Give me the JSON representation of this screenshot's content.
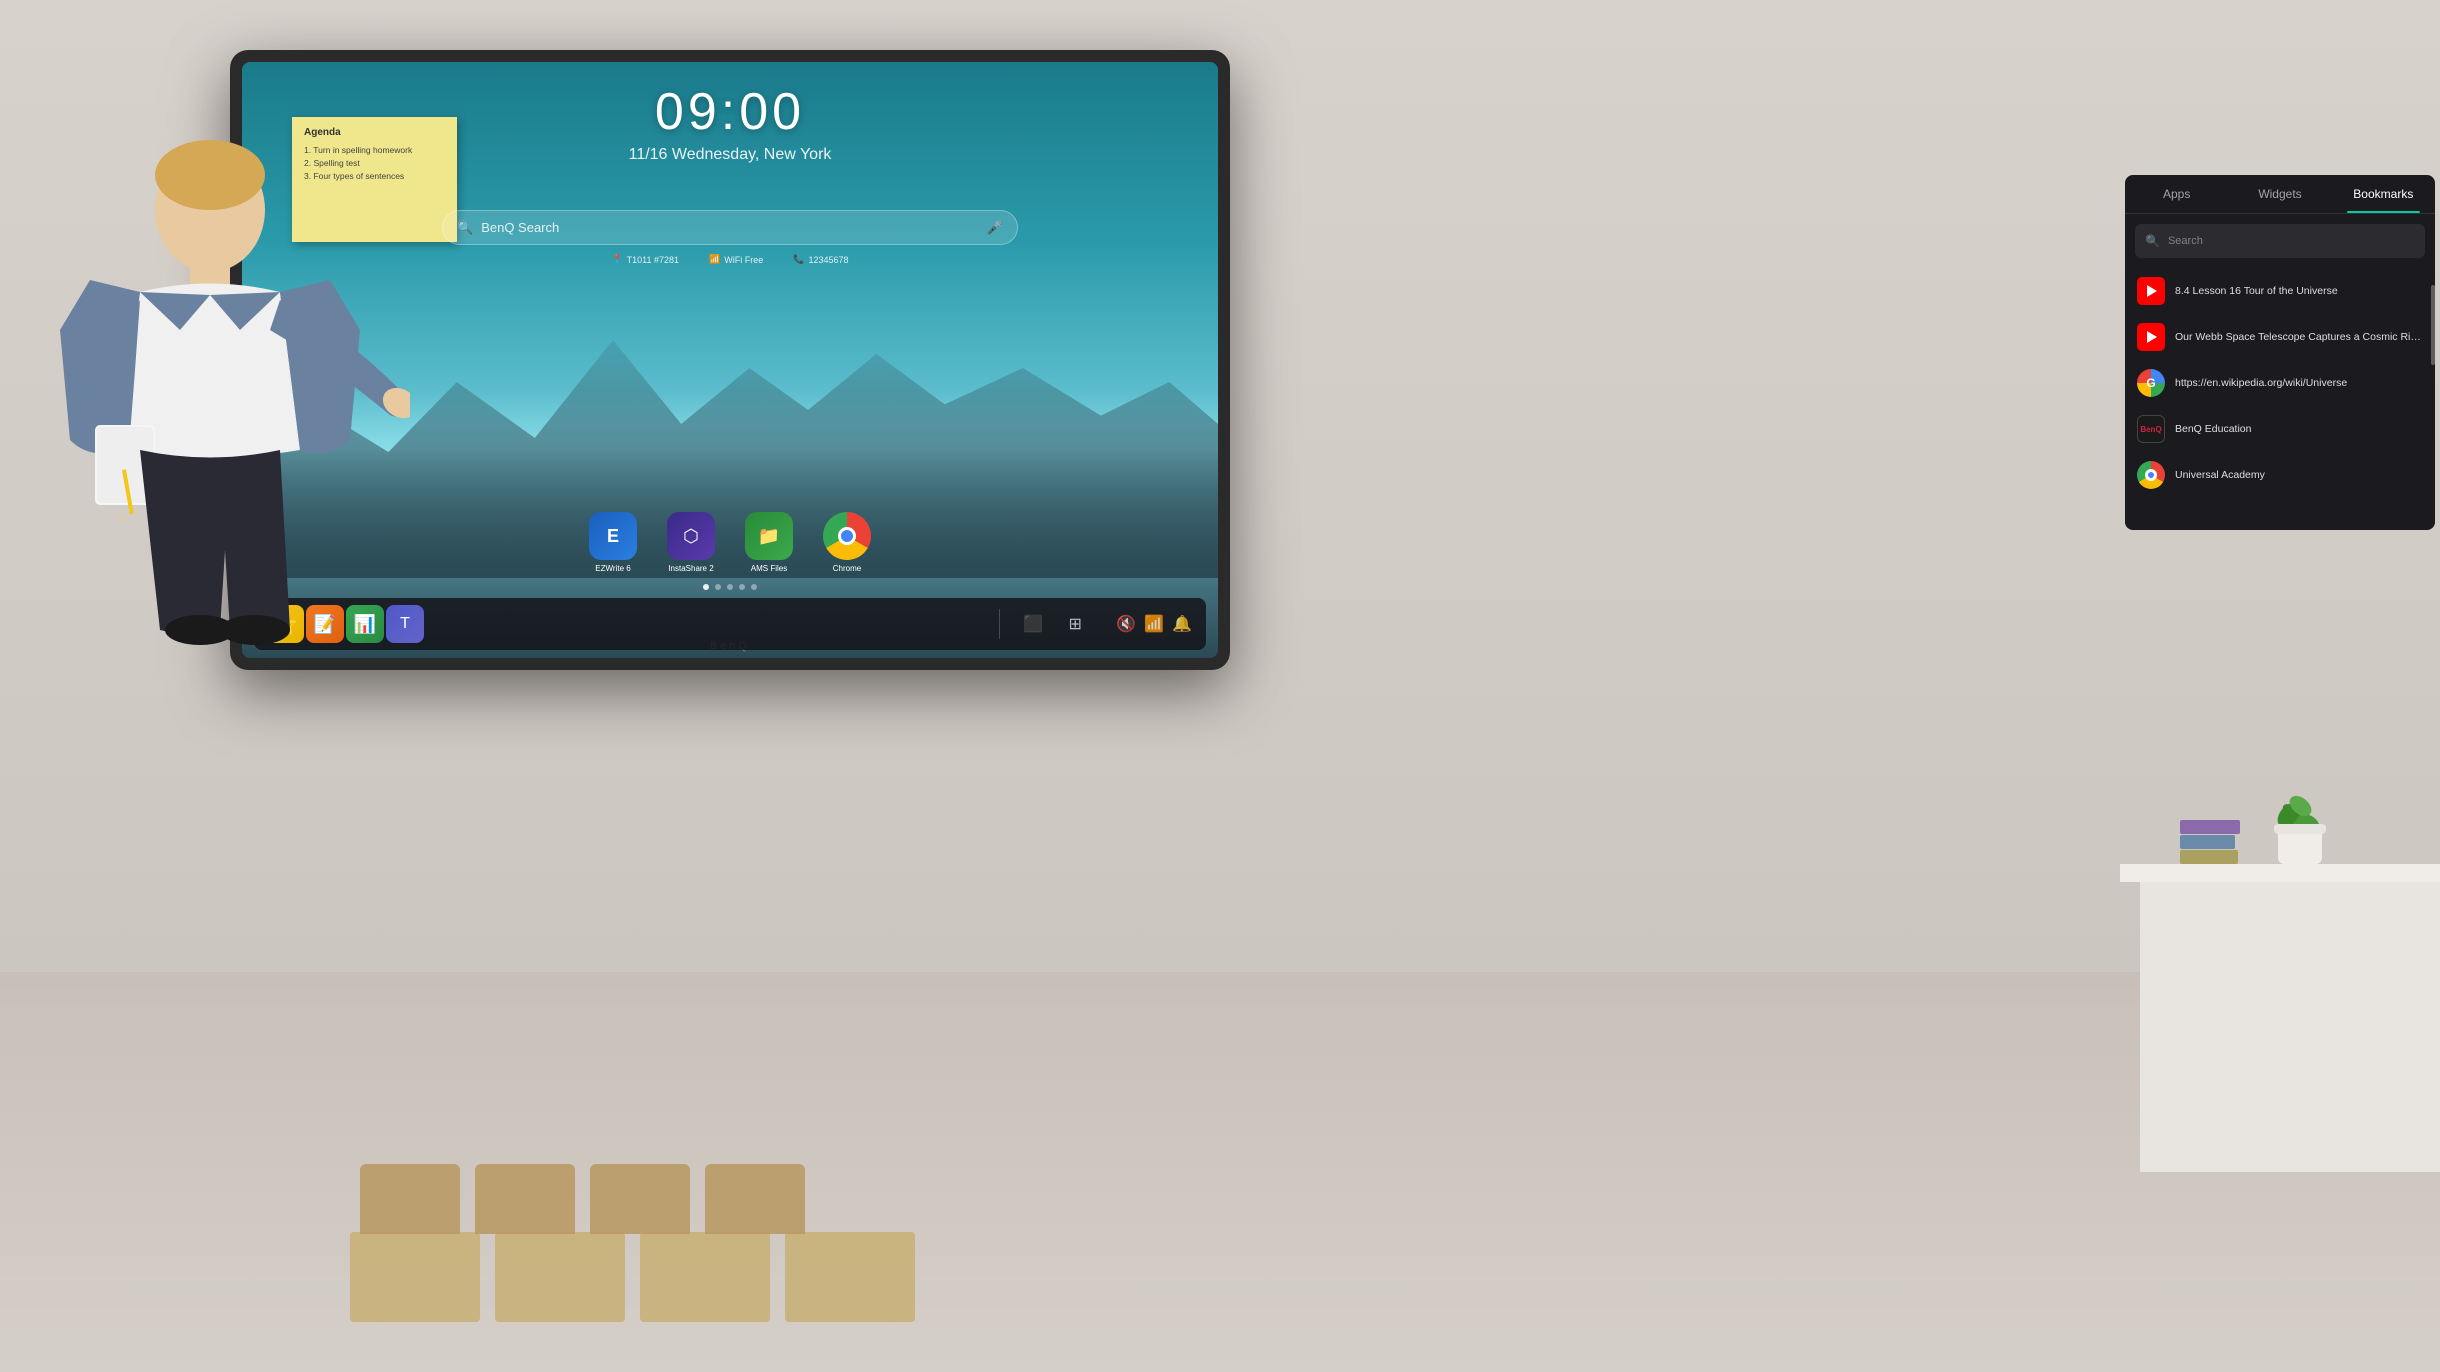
{
  "room": {
    "background": "#c8c0b8"
  },
  "tv": {
    "brand": "BenQ",
    "time": "09:00",
    "date": "11/16 Wednesday, New York",
    "search_placeholder": "BenQ Search",
    "info": {
      "device_id": "T1011 #7281",
      "wifi": "WiFi Free",
      "phone": "12345678"
    },
    "dots": [
      true,
      false,
      false,
      false,
      false
    ]
  },
  "sticky_note": {
    "title": "Agenda",
    "items": [
      "1.  Turn in spelling homework",
      "2.  Spelling test",
      "3.  Four types of sentences"
    ]
  },
  "apps": [
    {
      "label": "EZWrite 6",
      "icon_type": "ezwrite"
    },
    {
      "label": "InstaShare 2",
      "icon_type": "instashare"
    },
    {
      "label": "AMS Files",
      "icon_type": "ams"
    },
    {
      "label": "Chrome",
      "icon_type": "chrome"
    }
  ],
  "taskbar": {
    "left_icons": [
      {
        "name": "star-widget-icon",
        "type": "yellow"
      },
      {
        "name": "sticky-notes-icon",
        "type": "orange"
      },
      {
        "name": "sheets-icon",
        "type": "green"
      },
      {
        "name": "teams-icon",
        "type": "blue"
      }
    ],
    "right_icons": [
      {
        "name": "mute-icon",
        "symbol": "🔇"
      },
      {
        "name": "wifi-icon",
        "symbol": "📶"
      },
      {
        "name": "bell-icon",
        "symbol": "🔔"
      }
    ],
    "center_icons": [
      {
        "name": "input-source-icon",
        "symbol": "⬛"
      },
      {
        "name": "grid-icon",
        "symbol": "⊞"
      }
    ]
  },
  "bookmarks_panel": {
    "tabs": [
      {
        "label": "Apps",
        "active": false
      },
      {
        "label": "Widgets",
        "active": false
      },
      {
        "label": "Bookmarks",
        "active": true
      }
    ],
    "search_placeholder": "Search",
    "items": [
      {
        "title": "8.4 Lesson 16 Tour of the Universe",
        "icon_type": "youtube",
        "url": ""
      },
      {
        "title": "Our Webb Space Telescope Captures a Cosmic Ring on...",
        "icon_type": "youtube",
        "url": ""
      },
      {
        "title": "https://en.wikipedia.org/wiki/Universe",
        "icon_type": "google",
        "url": "https://en.wikipedia.org/wiki/Universe"
      },
      {
        "title": "BenQ Education",
        "icon_type": "benq",
        "url": ""
      },
      {
        "title": "Universal Academy",
        "icon_type": "chrome",
        "url": ""
      }
    ]
  }
}
